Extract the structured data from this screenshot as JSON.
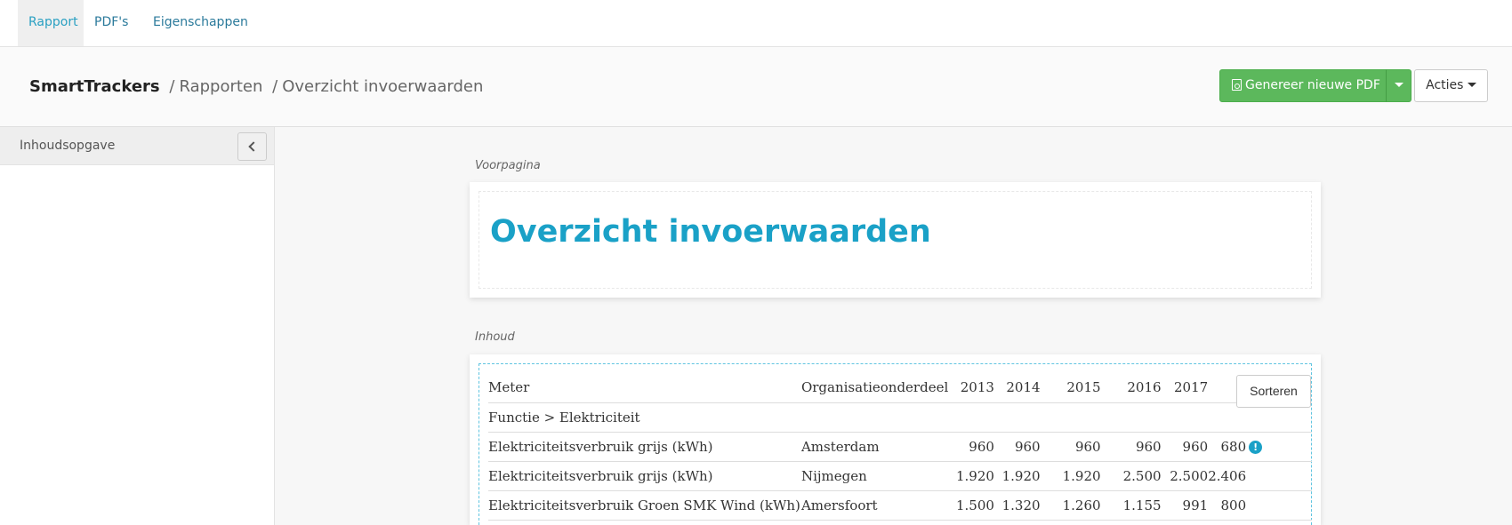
{
  "tabs": [
    {
      "label": "Rapport",
      "active": true
    },
    {
      "label": "PDF's",
      "active": false
    },
    {
      "label": "Eigenschappen",
      "active": false
    }
  ],
  "breadcrumb": {
    "root": "SmartTrackers",
    "separator": "/",
    "level1": "Rapporten",
    "level2": "Overzicht invoerwaarden"
  },
  "actions": {
    "generate_label": "Genereer nieuwe PDF",
    "acties_label": "Acties"
  },
  "sidebar": {
    "title": "Inhoudsopgave"
  },
  "sections": {
    "cover_label": "Voorpagina",
    "content_label": "Inhoud"
  },
  "cover": {
    "title": "Overzicht invoerwaarden"
  },
  "table": {
    "sort_label": "Sorteren",
    "headers": {
      "meter": "Meter",
      "org": "Organisatieonderdeel",
      "years": [
        "2013",
        "2014",
        "2015",
        "2016",
        "2017"
      ]
    },
    "group": "Functie > Elektriciteit",
    "rows": [
      {
        "meter": "Elektriciteitsverbruik grijs (kWh)",
        "org": "Amsterdam",
        "values": [
          "960",
          "960",
          "960",
          "960",
          "960",
          "680"
        ],
        "warning": true
      },
      {
        "meter": "Elektriciteitsverbruik grijs (kWh)",
        "org": "Nijmegen",
        "values": [
          "1.920",
          "1.920",
          "1.920",
          "2.500",
          "2.500",
          "2.406"
        ],
        "warning": false
      },
      {
        "meter": "Elektriciteitsverbruik Groen SMK Wind (kWh)",
        "org": "Amersfoort",
        "values": [
          "1.500",
          "1.320",
          "1.260",
          "1.155",
          "991",
          "800"
        ],
        "warning": false
      }
    ]
  },
  "colors": {
    "accent": "#1aa1c7",
    "tab_active": "#2aa0c2",
    "primary_button": "#5cb85c"
  },
  "icons": {
    "pdf": "pdf-file-icon",
    "warning": "exclamation-icon",
    "collapse": "chevron-left-icon"
  }
}
